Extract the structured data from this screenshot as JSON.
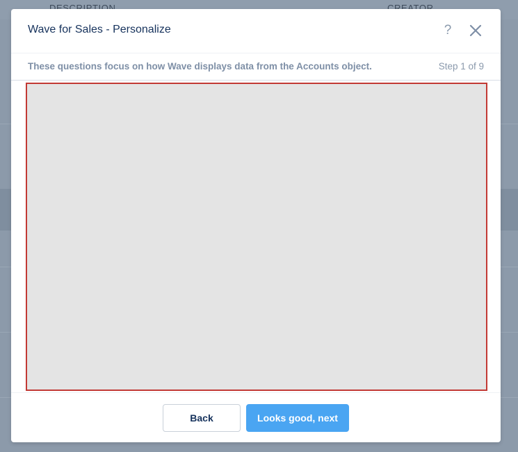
{
  "background": {
    "columns": {
      "description": "DESCRIPTION",
      "creator": "CREATOR"
    }
  },
  "modal": {
    "title": "Wave for Sales - Personalize",
    "help_icon": "help-icon",
    "close_icon": "close-icon",
    "subheader": {
      "text": "These questions focus on how Wave displays data from the Accounts object.",
      "step": "Step 1 of 9"
    },
    "footer": {
      "back_label": "Back",
      "next_label": "Looks good, next"
    }
  },
  "colors": {
    "primary_button": "#4aa5f2",
    "content_border": "#c23934",
    "title_text": "#16325c",
    "subtle_text": "#7e8fa6"
  }
}
